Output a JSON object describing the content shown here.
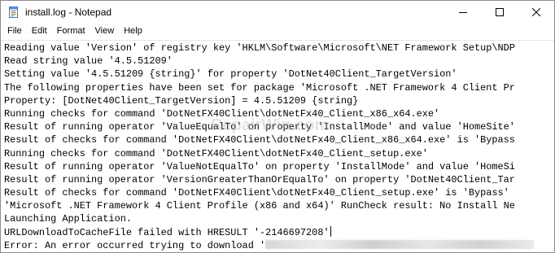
{
  "window": {
    "title": "install.log - Notepad",
    "controls": {
      "minimize": "minimize-icon",
      "maximize": "maximize-icon",
      "close": "close-icon"
    }
  },
  "menu": {
    "items": [
      {
        "label": "File"
      },
      {
        "label": "Edit"
      },
      {
        "label": "Format"
      },
      {
        "label": "View"
      },
      {
        "label": "Help"
      }
    ]
  },
  "document": {
    "lines": [
      "Reading value 'Version' of registry key 'HKLM\\Software\\Microsoft\\NET Framework Setup\\NDP",
      "Read string value '4.5.51209'",
      "Setting value '4.5.51209 {string}' for property 'DotNet40Client_TargetVersion'",
      "The following properties have been set for package 'Microsoft .NET Framework 4 Client Pr",
      "Property: [DotNet40Client_TargetVersion] = 4.5.51209 {string}",
      "Running checks for command 'DotNetFX40Client\\dotNetFx40_Client_x86_x64.exe'",
      "Result of running operator 'ValueEqualTo' on property 'InstallMode' and value 'HomeSite'",
      "Result of checks for command 'DotNetFX40Client\\dotNetFx40_Client_x86_x64.exe' is 'Bypass",
      "Running checks for command 'DotNetFX40Client\\dotNetFx40_Client_setup.exe'",
      "Result of running operator 'ValueNotEqualTo' on property 'InstallMode' and value 'HomeSi",
      "Result of running operator 'VersionGreaterThanOrEqualTo' on property 'DotNet40Client_Tar",
      "Result of checks for command 'DotNetFX40Client\\dotNetFx40_Client_setup.exe' is 'Bypass'",
      "'Microsoft .NET Framework 4 Client Profile (x86 and x64)' RunCheck result: No Install Ne",
      "Launching Application.",
      "URLDownloadToCacheFile failed with HRESULT '-2146697208'"
    ],
    "last_line_prefix": "Error: An error occurred trying to download '"
  },
  "watermark": {
    "text": "RepairWin.com"
  }
}
